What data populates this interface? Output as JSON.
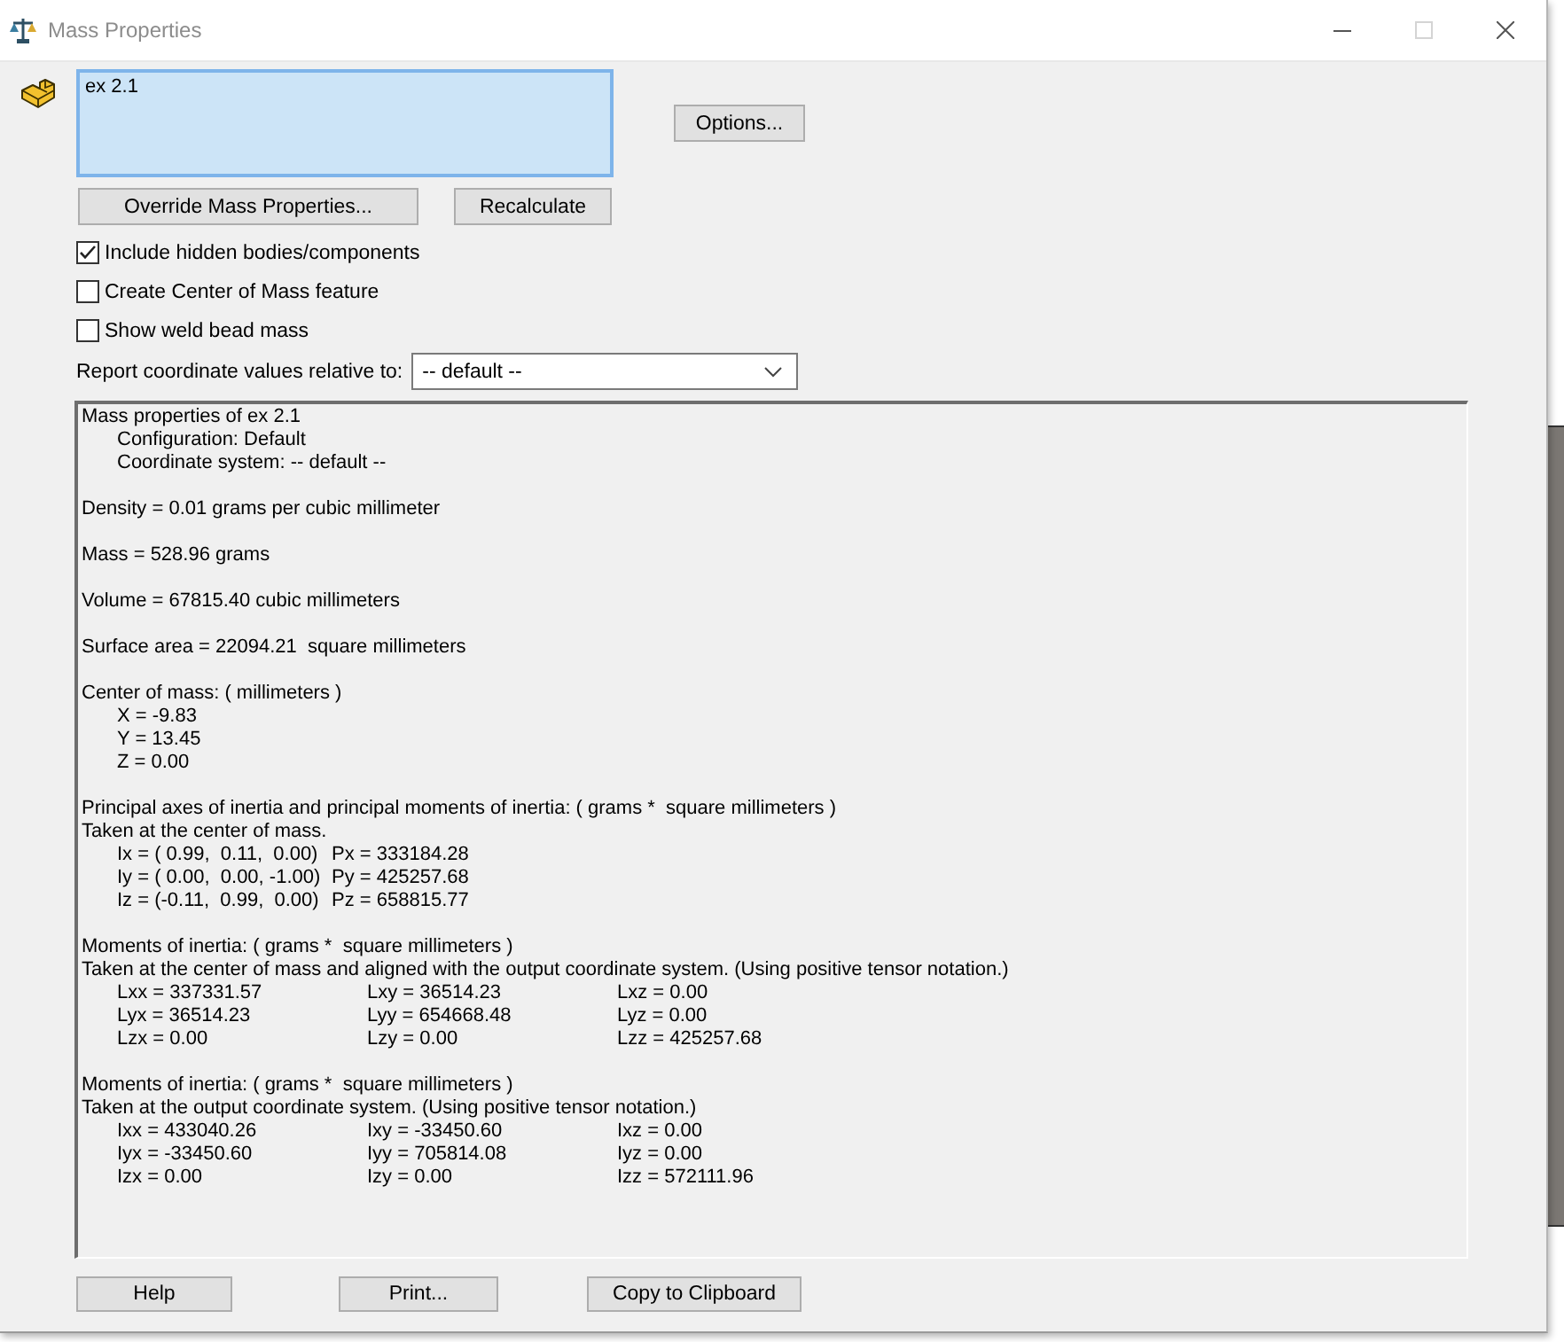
{
  "window": {
    "title": "Mass Properties",
    "controls": [
      {
        "kind": "minimize",
        "disabled": false
      },
      {
        "kind": "maximize",
        "disabled": true
      },
      {
        "kind": "close",
        "disabled": false
      }
    ]
  },
  "selection": {
    "items": [
      "ex 2.1"
    ]
  },
  "options_button": {
    "label": "Options..."
  },
  "action_buttons": [
    {
      "label": "Override Mass Properties..."
    },
    {
      "label": "Recalculate"
    }
  ],
  "checkboxes": [
    {
      "label": "Include hidden bodies/components",
      "checked": true
    },
    {
      "label": "Create Center of Mass feature",
      "checked": false
    },
    {
      "label": "Show weld bead mass",
      "checked": false
    }
  ],
  "coordinate_dropdown": {
    "label": "Report coordinate values relative to:",
    "value": "-- default --"
  },
  "report": {
    "blocks": [
      {
        "lines": [
          {
            "kind": "text",
            "text": "Mass properties of ex 2.1",
            "children": [
              {
                "kind": "text",
                "text": "Configuration: Default"
              },
              {
                "kind": "text",
                "text": "Coordinate system: -- default --"
              }
            ]
          }
        ]
      },
      {
        "lines": [
          {
            "kind": "text",
            "text": "Density = 0.01 grams per cubic millimeter"
          }
        ]
      },
      {
        "lines": [
          {
            "kind": "text",
            "text": "Mass = 528.96 grams"
          }
        ]
      },
      {
        "lines": [
          {
            "kind": "text",
            "text": "Volume = 67815.40 cubic millimeters"
          }
        ]
      },
      {
        "lines": [
          {
            "kind": "text",
            "text": "Surface area = 22094.21  square millimeters"
          }
        ]
      },
      {
        "lines": [
          {
            "kind": "text",
            "text": "Center of mass: ( millimeters )",
            "children": [
              {
                "kind": "text",
                "text": "X = -9.83"
              },
              {
                "kind": "text",
                "text": "Y = 13.45"
              },
              {
                "kind": "text",
                "text": "Z = 0.00"
              }
            ]
          }
        ]
      },
      {
        "lines": [
          {
            "kind": "text",
            "text": "Principal axes of inertia and principal moments of inertia: ( grams *  square millimeters )"
          },
          {
            "kind": "text",
            "text": "Taken at the center of mass.",
            "children": [
              {
                "kind": "row",
                "cells": [
                  "Ix = ( 0.99,  0.11,  0.00)",
                  "Px = 333184.28"
                ]
              },
              {
                "kind": "row",
                "cells": [
                  "Iy = ( 0.00,  0.00, -1.00)",
                  "Py = 425257.68"
                ]
              },
              {
                "kind": "row",
                "cells": [
                  "Iz = (-0.11,  0.99,  0.00)",
                  "Pz = 658815.77"
                ]
              }
            ]
          }
        ]
      },
      {
        "lines": [
          {
            "kind": "text",
            "text": "Moments of inertia: ( grams *  square millimeters )"
          },
          {
            "kind": "text",
            "text": "Taken at the center of mass and aligned with the output coordinate system. (Using positive tensor notation.)",
            "children": [
              {
                "kind": "row",
                "cells": [
                  "Lxx = 337331.57",
                  "Lxy = 36514.23",
                  "Lxz = 0.00"
                ]
              },
              {
                "kind": "row",
                "cells": [
                  "Lyx = 36514.23",
                  "Lyy = 654668.48",
                  "Lyz = 0.00"
                ]
              },
              {
                "kind": "row",
                "cells": [
                  "Lzx = 0.00",
                  "Lzy = 0.00",
                  "Lzz = 425257.68"
                ]
              }
            ]
          }
        ]
      },
      {
        "lines": [
          {
            "kind": "text",
            "text": "Moments of inertia: ( grams *  square millimeters )"
          },
          {
            "kind": "text",
            "text": "Taken at the output coordinate system. (Using positive tensor notation.)",
            "children": [
              {
                "kind": "row",
                "cells": [
                  "Ixx = 433040.26",
                  "Ixy = -33450.60",
                  "Ixz = 0.00"
                ]
              },
              {
                "kind": "row",
                "cells": [
                  "Iyx = -33450.60",
                  "Iyy = 705814.08",
                  "Iyz = 0.00"
                ]
              },
              {
                "kind": "row",
                "cells": [
                  "Izx = 0.00",
                  "Izy = 0.00",
                  "Izz = 572111.96"
                ]
              }
            ]
          }
        ]
      }
    ]
  },
  "bottom_buttons": [
    {
      "label": "Help"
    },
    {
      "label": "Print..."
    },
    {
      "label": "Copy to Clipboard"
    }
  ]
}
